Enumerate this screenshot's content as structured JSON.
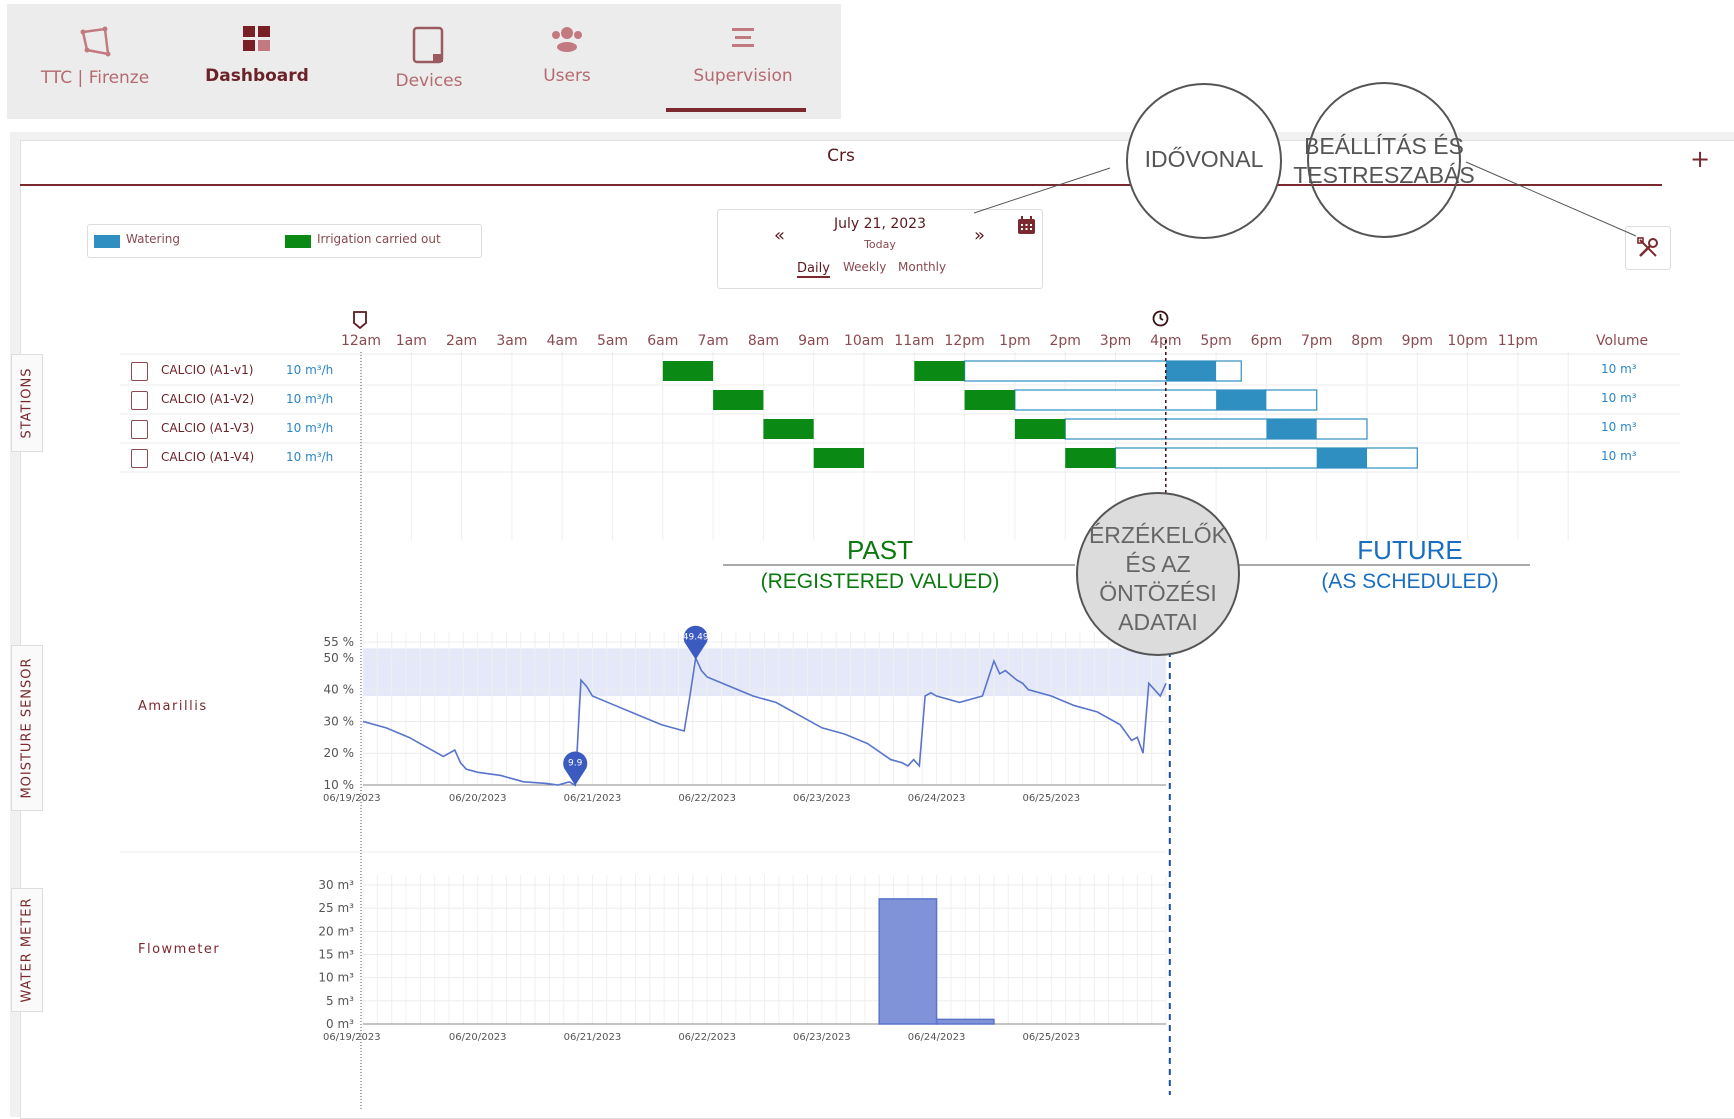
{
  "nav": {
    "items": [
      {
        "label": "TTC | Firenze",
        "icon": "polygon-icon"
      },
      {
        "label": "Dashboard",
        "icon": "dashboard-grid-icon"
      },
      {
        "label": "Devices",
        "icon": "device-icon"
      },
      {
        "label": "Users",
        "icon": "users-icon"
      },
      {
        "label": "Supervision",
        "icon": "menu-lines-icon"
      }
    ],
    "active": "Supervision"
  },
  "tab": {
    "title": "Crs",
    "add_label": "+"
  },
  "legend": {
    "items": [
      {
        "label": "Watering",
        "color": "#2f8fc0"
      },
      {
        "label": "Irrigation carried out",
        "color": "#0a8a14"
      }
    ]
  },
  "date_picker": {
    "prev": "«",
    "next": "»",
    "date": "July 21, 2023",
    "sub": "Today",
    "modes": [
      "Daily",
      "Weekly",
      "Monthly"
    ],
    "active_mode": "Daily"
  },
  "timeline": {
    "hours": [
      "12am",
      "1am",
      "2am",
      "3am",
      "4am",
      "5am",
      "6am",
      "7am",
      "8am",
      "9am",
      "10am",
      "11am",
      "12pm",
      "1pm",
      "2pm",
      "3pm",
      "4pm",
      "5pm",
      "6pm",
      "7pm",
      "8pm",
      "9pm",
      "10pm",
      "11pm"
    ],
    "volume_header": "Volume",
    "now_hour": 16,
    "stations": [
      {
        "name": "CALCIO (A1-v1)",
        "rate": "10 m³/h",
        "volume": "10 m³",
        "done": [
          [
            6,
            7
          ],
          [
            11,
            12
          ]
        ],
        "scheduled": [
          [
            12,
            17.5
          ]
        ],
        "watering": [
          [
            16,
            17
          ]
        ]
      },
      {
        "name": "CALCIO (A1-V2)",
        "rate": "10 m³/h",
        "volume": "10 m³",
        "done": [
          [
            7,
            8
          ],
          [
            12,
            13
          ]
        ],
        "scheduled": [
          [
            13,
            19
          ]
        ],
        "watering": [
          [
            17,
            18
          ]
        ]
      },
      {
        "name": "CALCIO (A1-V3)",
        "rate": "10 m³/h",
        "volume": "10 m³",
        "done": [
          [
            8,
            9
          ],
          [
            13,
            14
          ]
        ],
        "scheduled": [
          [
            14,
            20
          ]
        ],
        "watering": [
          [
            18,
            19
          ]
        ]
      },
      {
        "name": "CALCIO (A1-V4)",
        "rate": "10 m³/h",
        "volume": "10 m³",
        "done": [
          [
            9,
            10
          ],
          [
            14,
            15
          ]
        ],
        "scheduled": [
          [
            15,
            21
          ]
        ],
        "watering": [
          [
            19,
            20
          ]
        ]
      }
    ]
  },
  "side_tabs": {
    "stations": "STATIONS",
    "moisture": "MOISTURE SENSOR",
    "water": "WATER METER"
  },
  "callouts": {
    "timeline": "IDŐVONAL",
    "settings": "BEÁLLÍTÁS ÉS TESTRESZABÁS",
    "sensors": "ÉRZÉKELŐK ÉS AZ ÖNTÖZÉSI ADATAI",
    "past": "PAST",
    "past_sub": "(REGISTERED VALUED)",
    "future": "FUTURE",
    "future_sub": "(AS SCHEDULED)"
  },
  "colors": {
    "brand": "#7a2a2e",
    "watering": "#2f8fc0",
    "done": "#0a8a14",
    "chart": "#5a74cc",
    "band": "#e4e8f8"
  },
  "chart_data": [
    {
      "type": "line",
      "title": "Amarillis",
      "x_ticks": [
        "06/19/2023",
        "06/20/2023",
        "06/21/2023",
        "06/22/2023",
        "06/23/2023",
        "06/24/2023",
        "06/25/2023"
      ],
      "y_ticks": [
        "10 %",
        "20 %",
        "30 %",
        "40 %",
        "50 %",
        "55 %"
      ],
      "ylim": [
        10,
        55
      ],
      "xlim": [
        0,
        7
      ],
      "band": [
        38,
        53
      ],
      "series": [
        {
          "x": [
            0,
            0.2,
            0.4,
            0.6,
            0.7,
            0.8,
            0.85,
            0.9,
            1.0,
            1.2,
            1.4,
            1.6,
            1.7,
            1.75,
            1.8,
            1.85,
            1.9,
            1.95,
            2.0,
            2.2,
            2.4,
            2.6,
            2.8,
            2.85,
            2.9,
            2.95,
            3.0,
            3.2,
            3.4,
            3.6,
            3.8,
            4.0,
            4.2,
            4.4,
            4.6,
            4.7,
            4.75,
            4.8,
            4.85,
            4.9,
            4.95,
            5.0,
            5.2,
            5.4,
            5.5,
            5.55,
            5.6,
            5.7,
            5.75,
            5.8,
            6.0,
            6.2,
            6.4,
            6.6,
            6.7,
            6.75,
            6.8,
            6.85,
            6.9,
            6.95,
            7.0
          ],
          "y": [
            30,
            28,
            25,
            21,
            19,
            21,
            17,
            15,
            14,
            13,
            11,
            10.5,
            10,
            10.5,
            11,
            9.9,
            43,
            41,
            38,
            35,
            32,
            29,
            27,
            38,
            50,
            46,
            44,
            41,
            38,
            36,
            32,
            28,
            26,
            23,
            18,
            17,
            16,
            18,
            16,
            38,
            39,
            38,
            36,
            38,
            49,
            45,
            46,
            43,
            42,
            40,
            38,
            35,
            33,
            29,
            24,
            25,
            20,
            42,
            40,
            38,
            42
          ]
        }
      ],
      "markers": [
        {
          "x": 1.85,
          "y": 9.9,
          "label": "9.9"
        },
        {
          "x": 2.9,
          "y": 49.49,
          "label": "49.49"
        }
      ]
    },
    {
      "type": "bar",
      "title": "Flowmeter",
      "x_ticks": [
        "06/19/2023",
        "06/20/2023",
        "06/21/2023",
        "06/22/2023",
        "06/23/2023",
        "06/24/2023",
        "06/25/2023"
      ],
      "y_ticks": [
        "0 m³",
        "5 m³",
        "10 m³",
        "15 m³",
        "20 m³",
        "25 m³",
        "30 m³"
      ],
      "ylim": [
        0,
        30
      ],
      "xlim": [
        0,
        7
      ],
      "bars": [
        {
          "x0": 4.5,
          "x1": 5.0,
          "value": 27
        },
        {
          "x0": 5.0,
          "x1": 5.5,
          "value": 1
        }
      ]
    }
  ]
}
